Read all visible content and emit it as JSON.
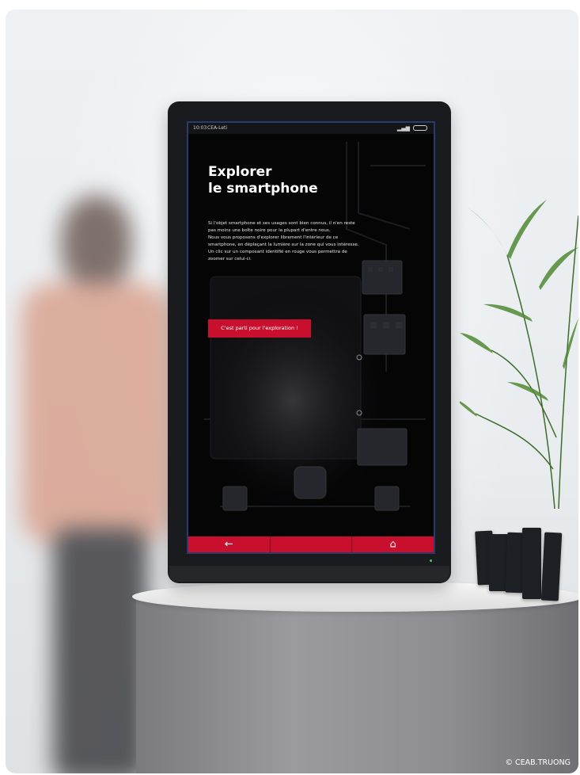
{
  "status_bar": {
    "time": "10:03",
    "carrier": "CEA-Leti",
    "signal_icon": "signal-icon",
    "battery_icon": "battery-icon"
  },
  "screen": {
    "title_line1": "Explorer",
    "title_line2": "le smartphone",
    "description_lines": [
      "Si l'objet smartphone et ses usages sont bien connus, il n'en reste",
      "pas moins une boîte noire pour la plupart d'entre nous.",
      "Nous vous proposons d'explorer librement l'intérieur de ce",
      "smartphone, en déplaçant la lumière sur la zone qui vous intéresse.",
      "Un clic sur un composant identifié en rouge vous permettra de",
      "zoomer sur celui-ci."
    ],
    "cta_label": "C'est parti pour l'exploration !"
  },
  "nav": {
    "back_glyph": "←",
    "home_glyph": "⌂",
    "back_icon": "arrow-left-icon",
    "home_icon": "home-icon"
  },
  "colors": {
    "accent_red": "#c8102e",
    "screen_bg": "#050506",
    "kiosk_frame": "#1a1b1f"
  },
  "photo_credit": "© CEAB.TRUONG"
}
